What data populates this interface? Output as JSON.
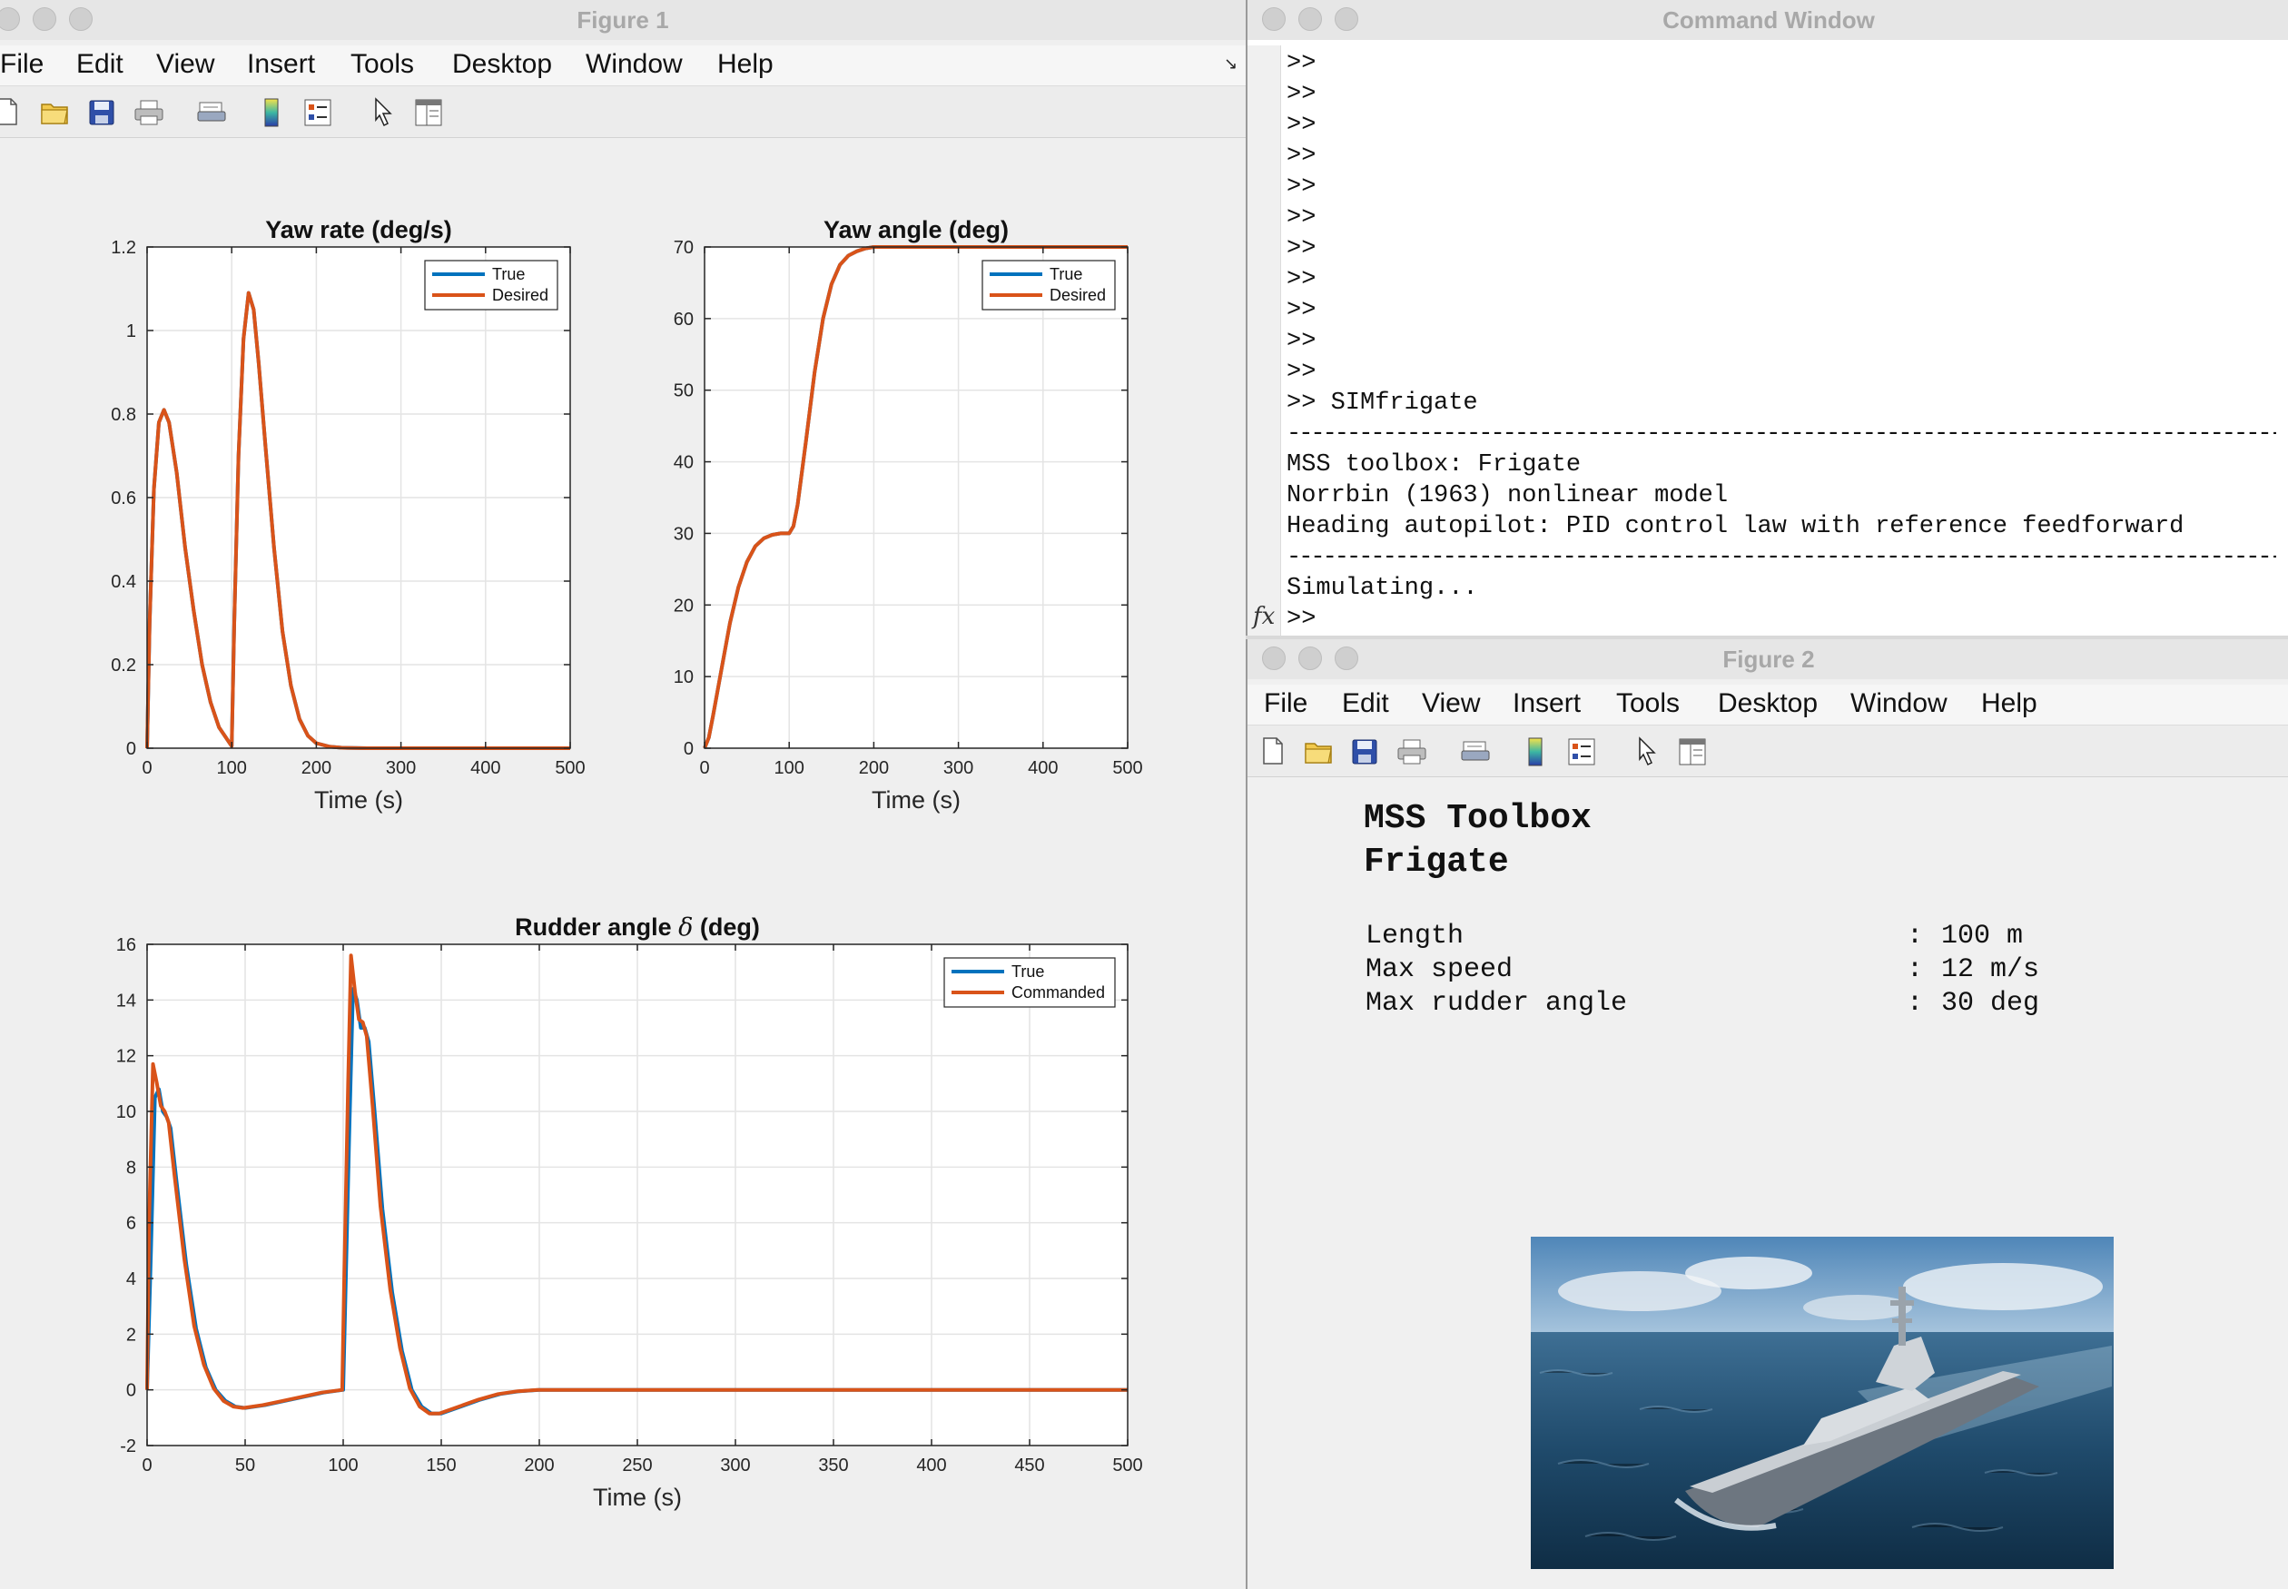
{
  "figure1": {
    "title": "Figure 1",
    "menu": [
      "File",
      "Edit",
      "View",
      "Insert",
      "Tools",
      "Desktop",
      "Window",
      "Help"
    ],
    "dock_arrow": "↘",
    "toolbar_icons": [
      "new-figure-icon",
      "open-folder-icon",
      "save-disk-icon",
      "print-icon",
      "print-preview-icon",
      "colorbar-icon",
      "legend-icon",
      "pointer-icon",
      "property-editor-icon"
    ]
  },
  "command_window": {
    "title": "Command Window",
    "prompt_lines": [
      ">>",
      ">>",
      ">>",
      ">>",
      ">>",
      ">>",
      ">>",
      ">>",
      ">>",
      ">>",
      ">>"
    ],
    "command": ">> SIMfrigate",
    "separator": "--------------------------------------------------------------------------------------------------------------",
    "output_lines": [
      "MSS toolbox: Frigate",
      "Norrbin (1963) nonlinear model",
      "Heading autopilot: PID control law with reference feedforward"
    ],
    "simulating": "Simulating...",
    "fx_label": "fx",
    "current_prompt": ">>"
  },
  "figure2": {
    "title": "Figure 2",
    "menu": [
      "File",
      "Edit",
      "View",
      "Insert",
      "Tools",
      "Desktop",
      "Window",
      "Help"
    ],
    "heading_line1": "MSS Toolbox",
    "heading_line2": "Frigate",
    "specs": [
      {
        "label": "Length",
        "sep": ":",
        "value": "100 m"
      },
      {
        "label": "Max speed",
        "sep": ":",
        "value": "12 m/s"
      },
      {
        "label": "Max rudder angle",
        "sep": ":",
        "value": "30 deg"
      }
    ],
    "image": "frigate-ship-photo"
  },
  "colors": {
    "true_series": "#0072BD",
    "desired_series": "#D95319",
    "grid": "#e4e4e4"
  },
  "chart_data": [
    {
      "type": "line",
      "title": "Yaw rate (deg/s)",
      "xlabel": "Time (s)",
      "ylabel": "",
      "xlim": [
        0,
        500
      ],
      "ylim": [
        0,
        1.2
      ],
      "xticks": [
        0,
        100,
        200,
        300,
        400,
        500
      ],
      "yticks": [
        0,
        0.2,
        0.4,
        0.6,
        0.8,
        1,
        1.2
      ],
      "ytick_labels": [
        "0",
        "0.2",
        "0.4",
        "0.6",
        "0.8",
        "1",
        "1.2"
      ],
      "grid": true,
      "legend": "top-right",
      "series": [
        {
          "name": "True",
          "x": [
            0,
            3,
            8,
            14,
            20,
            26,
            35,
            45,
            55,
            65,
            75,
            85,
            95,
            100,
            103,
            108,
            114,
            120,
            126,
            132,
            140,
            150,
            160,
            170,
            180,
            190,
            200,
            215,
            230,
            260,
            300,
            400,
            500
          ],
          "y": [
            0,
            0.3,
            0.62,
            0.78,
            0.81,
            0.78,
            0.66,
            0.48,
            0.33,
            0.2,
            0.11,
            0.05,
            0.02,
            0.005,
            0.3,
            0.7,
            0.98,
            1.09,
            1.05,
            0.92,
            0.72,
            0.48,
            0.28,
            0.15,
            0.07,
            0.03,
            0.012,
            0.004,
            0.001,
            0,
            0,
            0,
            0
          ]
        },
        {
          "name": "Desired",
          "x": [
            0,
            3,
            8,
            14,
            20,
            26,
            35,
            45,
            55,
            65,
            75,
            85,
            95,
            100,
            103,
            108,
            114,
            120,
            126,
            132,
            140,
            150,
            160,
            170,
            180,
            190,
            200,
            215,
            230,
            260,
            300,
            400,
            500
          ],
          "y": [
            0,
            0.3,
            0.62,
            0.78,
            0.81,
            0.78,
            0.66,
            0.48,
            0.33,
            0.2,
            0.11,
            0.05,
            0.02,
            0.005,
            0.3,
            0.7,
            0.98,
            1.09,
            1.05,
            0.92,
            0.72,
            0.48,
            0.28,
            0.15,
            0.07,
            0.03,
            0.012,
            0.004,
            0.001,
            0,
            0,
            0,
            0
          ]
        }
      ]
    },
    {
      "type": "line",
      "title": "Yaw angle (deg)",
      "xlabel": "Time (s)",
      "ylabel": "",
      "xlim": [
        0,
        500
      ],
      "ylim": [
        0,
        70
      ],
      "xticks": [
        0,
        100,
        200,
        300,
        400,
        500
      ],
      "yticks": [
        0,
        10,
        20,
        30,
        40,
        50,
        60,
        70
      ],
      "ytick_labels": [
        "0",
        "10",
        "20",
        "30",
        "40",
        "50",
        "60",
        "70"
      ],
      "grid": true,
      "legend": "top-right",
      "series": [
        {
          "name": "True",
          "x": [
            0,
            5,
            10,
            20,
            30,
            40,
            50,
            60,
            70,
            80,
            90,
            100,
            105,
            110,
            120,
            130,
            140,
            150,
            160,
            170,
            180,
            190,
            200,
            220,
            250,
            300,
            400,
            500
          ],
          "y": [
            0,
            1.5,
            4.5,
            11,
            17.5,
            22.5,
            26,
            28.2,
            29.3,
            29.8,
            30,
            30,
            31,
            34,
            43,
            52.5,
            60,
            64.8,
            67.5,
            68.8,
            69.4,
            69.8,
            70,
            70,
            70,
            70,
            70,
            70
          ]
        },
        {
          "name": "Desired",
          "x": [
            0,
            5,
            10,
            20,
            30,
            40,
            50,
            60,
            70,
            80,
            90,
            100,
            105,
            110,
            120,
            130,
            140,
            150,
            160,
            170,
            180,
            190,
            200,
            220,
            250,
            300,
            400,
            500
          ],
          "y": [
            0,
            1.5,
            4.5,
            11,
            17.5,
            22.5,
            26,
            28.2,
            29.3,
            29.8,
            30,
            30,
            31,
            34,
            43,
            52.5,
            60,
            64.8,
            67.5,
            68.8,
            69.4,
            69.8,
            70,
            70,
            70,
            70,
            70,
            70
          ]
        }
      ]
    },
    {
      "type": "line",
      "title": "Rudder angle",
      "title_symbol": "δ",
      "title_suffix": "(deg)",
      "xlabel": "Time (s)",
      "ylabel": "",
      "xlim": [
        0,
        500
      ],
      "ylim": [
        -2,
        16
      ],
      "xticks": [
        0,
        50,
        100,
        150,
        200,
        250,
        300,
        350,
        400,
        450,
        500
      ],
      "yticks": [
        -2,
        0,
        2,
        4,
        6,
        8,
        10,
        12,
        14,
        16
      ],
      "ytick_labels": [
        "-2",
        "0",
        "2",
        "4",
        "6",
        "8",
        "10",
        "12",
        "14",
        "16"
      ],
      "grid": true,
      "legend": "top-right",
      "series": [
        {
          "name": "True",
          "x": [
            0,
            2,
            4,
            6,
            8,
            10,
            12,
            15,
            20,
            25,
            30,
            35,
            40,
            45,
            50,
            60,
            70,
            80,
            90,
            100,
            101,
            103,
            105,
            107,
            109,
            111,
            113,
            116,
            120,
            125,
            130,
            135,
            140,
            145,
            150,
            160,
            170,
            180,
            190,
            200,
            220,
            250,
            300,
            400,
            500
          ],
          "y": [
            0,
            5,
            10.5,
            10.8,
            10,
            9.8,
            9.4,
            7.5,
            4.5,
            2.2,
            0.8,
            0,
            -0.4,
            -0.6,
            -0.65,
            -0.55,
            -0.4,
            -0.25,
            -0.1,
            0,
            3,
            9,
            14.4,
            14,
            13,
            13,
            12.5,
            10,
            6.5,
            3.5,
            1.4,
            0,
            -0.6,
            -0.85,
            -0.85,
            -0.6,
            -0.35,
            -0.15,
            -0.05,
            0,
            0,
            0,
            0,
            0,
            0
          ]
        },
        {
          "name": "Commanded",
          "x": [
            0,
            1,
            3,
            5,
            7,
            9,
            11,
            14,
            19,
            24,
            29,
            34,
            39,
            44,
            49,
            59,
            69,
            79,
            89,
            99.5,
            100.5,
            102.5,
            104,
            106,
            108,
            110,
            112,
            115,
            119,
            124,
            129,
            134,
            139,
            144,
            149,
            159,
            169,
            179,
            189,
            199,
            219,
            249,
            299,
            400,
            500
          ],
          "y": [
            0,
            6,
            11.7,
            11,
            10.2,
            10,
            9.6,
            7.7,
            4.7,
            2.3,
            0.9,
            0.05,
            -0.4,
            -0.6,
            -0.65,
            -0.55,
            -0.4,
            -0.25,
            -0.1,
            0,
            4,
            11,
            15.6,
            14.3,
            13.3,
            13.2,
            12.7,
            10.2,
            6.6,
            3.6,
            1.5,
            0.05,
            -0.6,
            -0.85,
            -0.85,
            -0.6,
            -0.35,
            -0.15,
            -0.05,
            0,
            0,
            0,
            0,
            0,
            0
          ]
        }
      ]
    }
  ]
}
